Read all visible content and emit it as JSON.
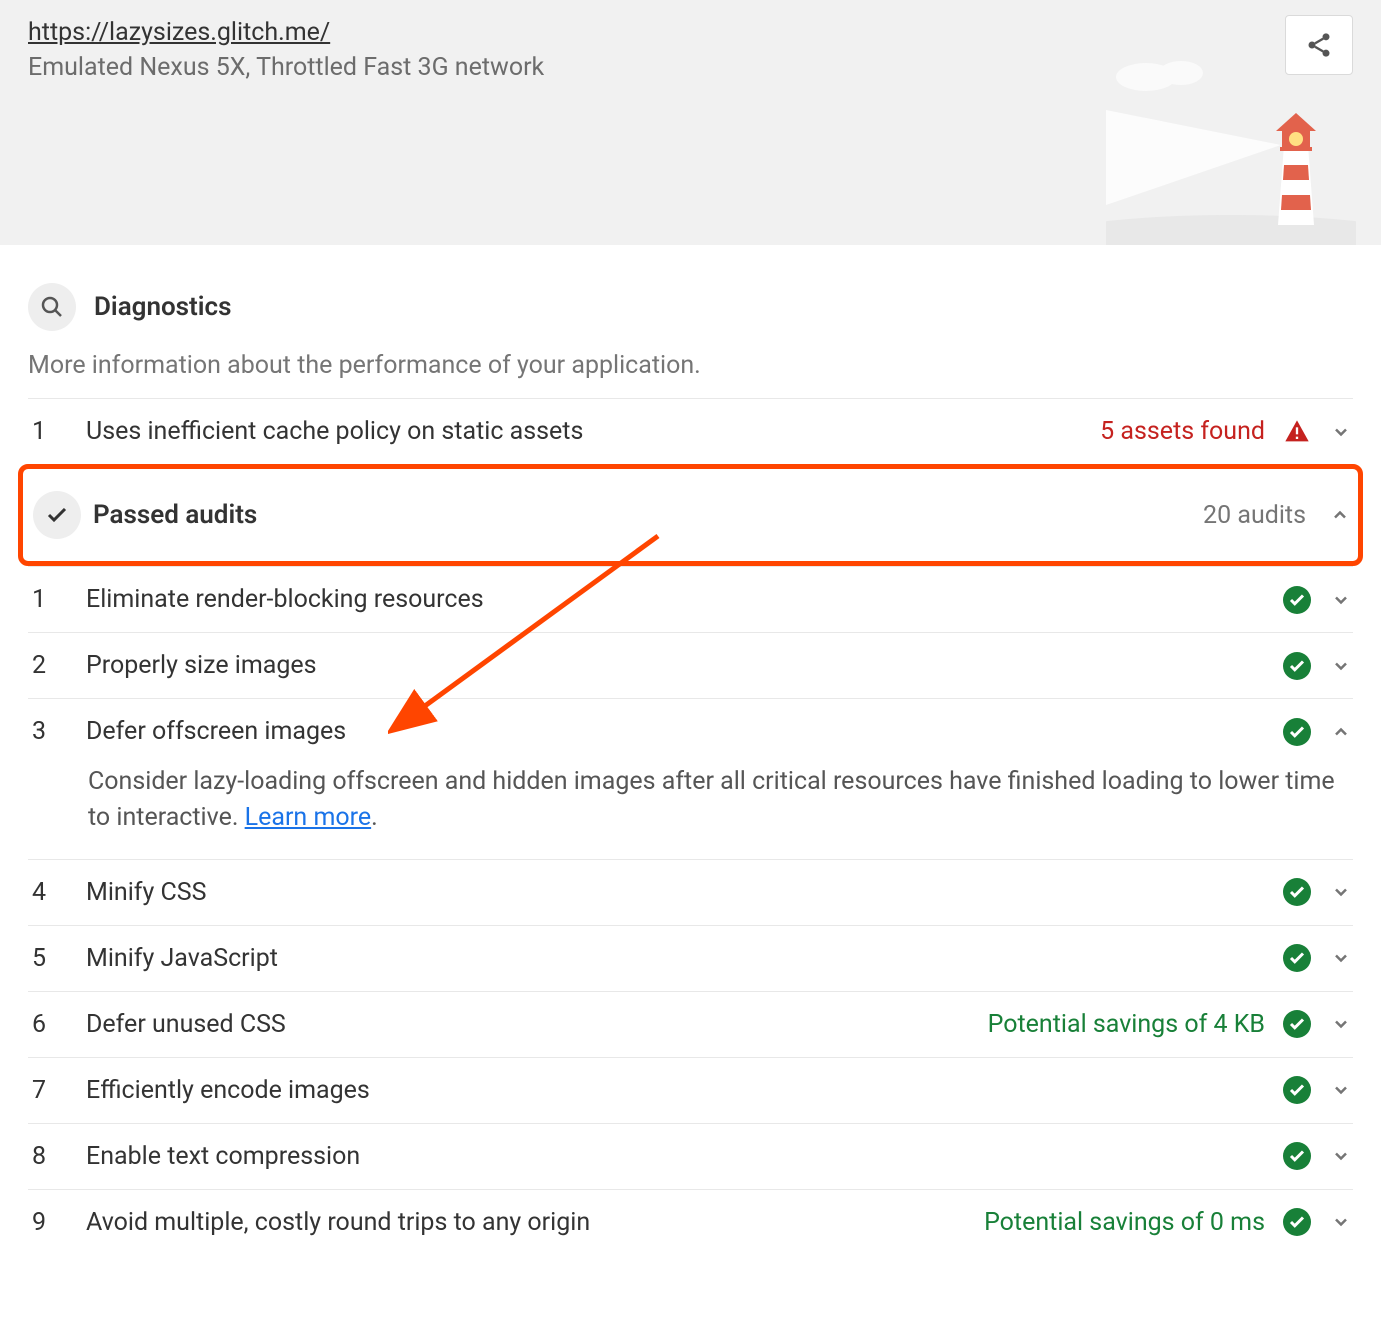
{
  "header": {
    "url": "https://lazysizes.glitch.me/",
    "subtitle": "Emulated Nexus 5X, Throttled Fast 3G network"
  },
  "diagnostics": {
    "title": "Diagnostics",
    "description": "More information about the performance of your application."
  },
  "failed_audit": {
    "num": "1",
    "title": "Uses inefficient cache policy on static assets",
    "summary": "5 assets found"
  },
  "passed": {
    "title": "Passed audits",
    "count": "20 audits"
  },
  "audits": [
    {
      "num": "1",
      "title": "Eliminate render-blocking resources",
      "summary": "",
      "expanded": false
    },
    {
      "num": "2",
      "title": "Properly size images",
      "summary": "",
      "expanded": false
    },
    {
      "num": "3",
      "title": "Defer offscreen images",
      "summary": "",
      "expanded": true,
      "description": "Consider lazy-loading offscreen and hidden images after all critical resources have finished loading to lower time to interactive. ",
      "link_text": "Learn more"
    },
    {
      "num": "4",
      "title": "Minify CSS",
      "summary": "",
      "expanded": false
    },
    {
      "num": "5",
      "title": "Minify JavaScript",
      "summary": "",
      "expanded": false
    },
    {
      "num": "6",
      "title": "Defer unused CSS",
      "summary": "Potential savings of 4 KB",
      "expanded": false
    },
    {
      "num": "7",
      "title": "Efficiently encode images",
      "summary": "",
      "expanded": false
    },
    {
      "num": "8",
      "title": "Enable text compression",
      "summary": "",
      "expanded": false
    },
    {
      "num": "9",
      "title": "Avoid multiple, costly round trips to any origin",
      "summary": "Potential savings of 0 ms",
      "expanded": false
    }
  ]
}
